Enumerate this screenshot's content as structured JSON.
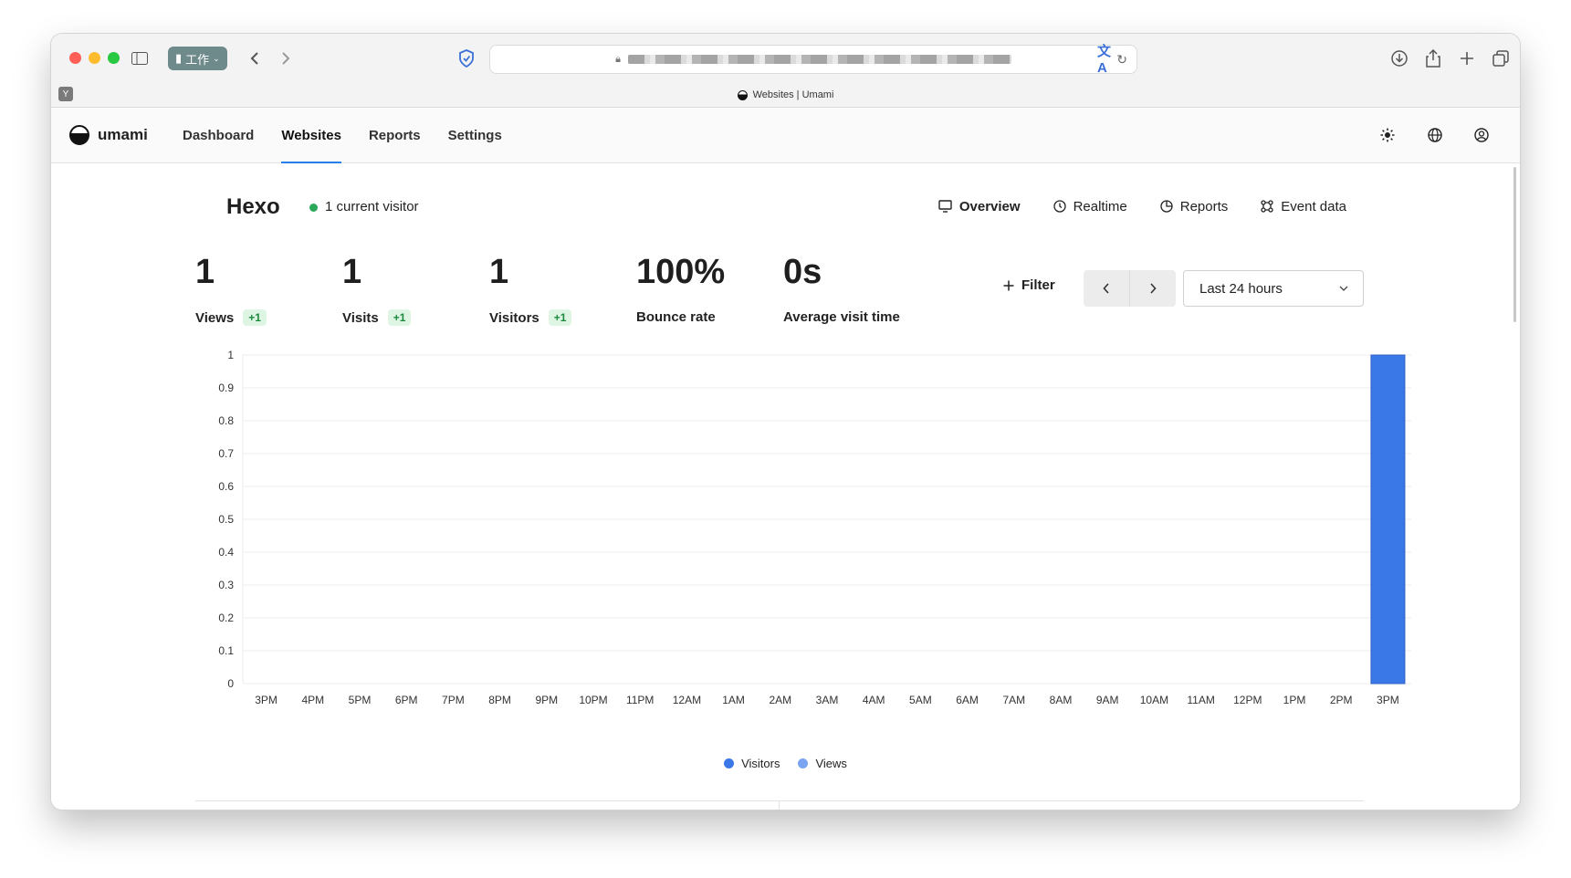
{
  "browser": {
    "profile_label": "工作",
    "tab_title": "Websites | Umami",
    "tab_favicon_letter": "Y"
  },
  "app": {
    "name": "umami",
    "nav": [
      {
        "label": "Dashboard",
        "active": false
      },
      {
        "label": "Websites",
        "active": true
      },
      {
        "label": "Reports",
        "active": false
      },
      {
        "label": "Settings",
        "active": false
      }
    ],
    "nav_icons": [
      "theme-sun-icon",
      "globe-icon",
      "profile-icon"
    ]
  },
  "website": {
    "title": "Hexo",
    "current_visitors": "1 current visitor",
    "view_tabs": [
      {
        "label": "Overview",
        "icon": "monitor-icon",
        "active": true
      },
      {
        "label": "Realtime",
        "icon": "clock-icon",
        "active": false
      },
      {
        "label": "Reports",
        "icon": "reports-icon",
        "active": false
      },
      {
        "label": "Event data",
        "icon": "event-data-icon",
        "active": false
      }
    ]
  },
  "metrics": [
    {
      "value": "1",
      "label": "Views",
      "change": "+1"
    },
    {
      "value": "1",
      "label": "Visits",
      "change": "+1"
    },
    {
      "value": "1",
      "label": "Visitors",
      "change": "+1"
    },
    {
      "value": "100%",
      "label": "Bounce rate",
      "change": ""
    },
    {
      "value": "0s",
      "label": "Average visit time",
      "change": ""
    }
  ],
  "controls": {
    "filter_label": "Filter",
    "date_range": "Last 24 hours"
  },
  "chart_data": {
    "type": "bar",
    "categories": [
      "3PM",
      "4PM",
      "5PM",
      "6PM",
      "7PM",
      "8PM",
      "9PM",
      "10PM",
      "11PM",
      "12AM",
      "1AM",
      "2AM",
      "3AM",
      "4AM",
      "5AM",
      "6AM",
      "7AM",
      "8AM",
      "9AM",
      "10AM",
      "11AM",
      "12PM",
      "1PM",
      "2PM",
      "3PM"
    ],
    "series": [
      {
        "name": "Visitors",
        "color": "#3b78e7",
        "values": [
          0,
          0,
          0,
          0,
          0,
          0,
          0,
          0,
          0,
          0,
          0,
          0,
          0,
          0,
          0,
          0,
          0,
          0,
          0,
          0,
          0,
          0,
          0,
          0,
          1
        ]
      },
      {
        "name": "Views",
        "color": "#7aa4f0",
        "values": [
          0,
          0,
          0,
          0,
          0,
          0,
          0,
          0,
          0,
          0,
          0,
          0,
          0,
          0,
          0,
          0,
          0,
          0,
          0,
          0,
          0,
          0,
          0,
          0,
          1
        ]
      }
    ],
    "yticks": [
      "0",
      "0.1",
      "0.2",
      "0.3",
      "0.4",
      "0.5",
      "0.6",
      "0.7",
      "0.8",
      "0.9",
      "1"
    ],
    "ylim": [
      0,
      1
    ],
    "grid": true,
    "legend": "bottom-center"
  }
}
